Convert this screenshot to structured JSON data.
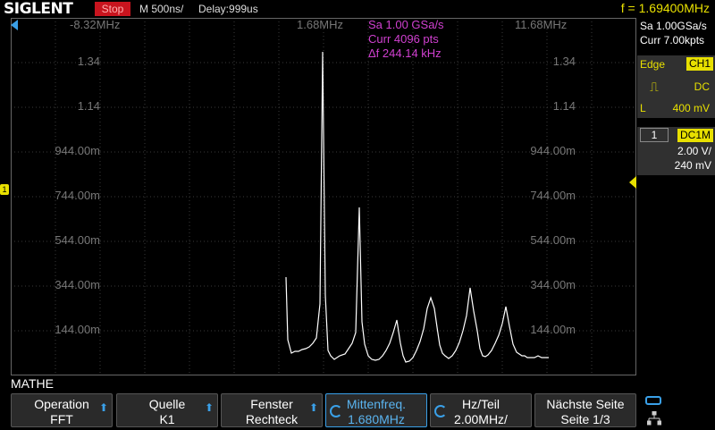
{
  "header": {
    "logo": "SIGLENT",
    "run_state": "Stop",
    "timebase": "M 500ns/",
    "delay": "Delay:999us",
    "frequency": "f = 1.69400MHz"
  },
  "fft_readout": {
    "sample_rate": "Sa 1.00 GSa/s",
    "points": "Curr 4096 pts",
    "delta_f": "Δf 244.14 kHz"
  },
  "x_labels": {
    "left": "-8.32MHz",
    "center": "1.68MHz",
    "right": "11.68MHz"
  },
  "y_labels": [
    "1.34",
    "1.14",
    "944.00m",
    "744.00m",
    "544.00m",
    "344.00m",
    "144.00m"
  ],
  "acquisition": {
    "rate": "Sa 1.00GSa/s",
    "depth": "Curr 7.00kpts"
  },
  "trigger": {
    "mode": "Edge",
    "source": "CH1",
    "coupling": "DC",
    "level_label": "L",
    "level": "400 mV"
  },
  "channel": {
    "number": "1",
    "coupling": "DC1M",
    "scale": "2.00 V/",
    "offset": "240 mV"
  },
  "menu_title": "MATHE",
  "softkeys": [
    {
      "line1": "Operation",
      "line2": "FFT"
    },
    {
      "line1": "Quelle",
      "line2": "K1"
    },
    {
      "line1": "Fenster",
      "line2": "Rechteck"
    },
    {
      "line1": "Mittenfreq.",
      "line2": "1.680MHz"
    },
    {
      "line1": "Hz/Teil",
      "line2": "2.00MHz/"
    },
    {
      "line1": "Nächste Seite",
      "line2": "Seite 1/3"
    }
  ],
  "colors": {
    "trace": "#ffffff",
    "readout": "#d040d0",
    "accent": "#e8e000",
    "grid": "#3a3a3a",
    "select": "#3aa0e8"
  },
  "spectrum": {
    "x": [
      320,
      322,
      326,
      330,
      334,
      338,
      342,
      346,
      350,
      354,
      358,
      361,
      364,
      367,
      370,
      374,
      380,
      386,
      390,
      394,
      398,
      402,
      405,
      408,
      412,
      416,
      420,
      424,
      428,
      432,
      436,
      440,
      444,
      448,
      451,
      454,
      458,
      462,
      466,
      470,
      474,
      478,
      482,
      486,
      489,
      492,
      495,
      498,
      502,
      506,
      510,
      514,
      518,
      522,
      526,
      530,
      534,
      537,
      540,
      543,
      546,
      550,
      554,
      558,
      562,
      566,
      570,
      574,
      578,
      581,
      584,
      587,
      590,
      594,
      598,
      602,
      606,
      610,
      614
    ],
    "y": [
      310,
      380,
      395,
      393,
      393,
      391,
      390,
      388,
      384,
      378,
      340,
      58,
      330,
      392,
      398,
      402,
      398,
      396,
      390,
      384,
      372,
      232,
      360,
      385,
      398,
      402,
      403,
      402,
      398,
      392,
      384,
      372,
      358,
      384,
      398,
      405,
      404,
      400,
      392,
      382,
      368,
      345,
      333,
      345,
      366,
      386,
      395,
      398,
      401,
      398,
      392,
      383,
      370,
      353,
      322,
      348,
      370,
      390,
      398,
      399,
      397,
      392,
      384,
      375,
      362,
      343,
      365,
      385,
      394,
      396,
      398,
      398,
      400,
      400,
      400,
      398,
      400,
      400,
      400
    ]
  }
}
